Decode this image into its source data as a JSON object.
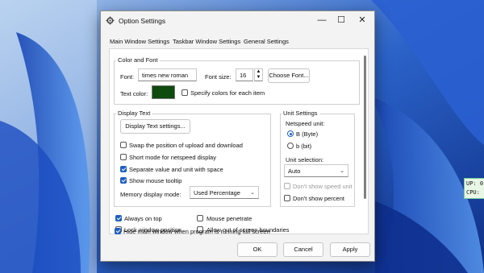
{
  "colors": {
    "wallpaper": "#1f53b8",
    "accent": "#1f5fbf",
    "text_color_swatch": "#0f4a0f"
  },
  "window": {
    "title": "Option Settings",
    "app_icon": "settings-app-icon",
    "minimize": "—",
    "maximize": "☐",
    "close": "✕"
  },
  "tabs": [
    "Main Window Settings",
    "Taskbar Window Settings",
    "General Settings"
  ],
  "color_font": {
    "group_label": "Color and Font",
    "font_label": "Font:",
    "font_value": "times new roman",
    "font_size_label": "Font size:",
    "font_size_value": "16",
    "choose_font_button": "Choose Font...",
    "text_color_label": "Text color:",
    "specify_colors_label": "Specify colors for each item"
  },
  "display_text": {
    "group_label": "Display Text",
    "settings_button": "Display Text settings...",
    "options": [
      {
        "label": "Swap the position of upload and download",
        "checked": false
      },
      {
        "label": "Short mode for netspeed display",
        "checked": false
      },
      {
        "label": "Separate value and unit with space",
        "checked": true
      },
      {
        "label": "Show mouse tooltip",
        "checked": true
      }
    ],
    "memory_mode_label": "Memory display mode:",
    "memory_mode_value": "Used Percentage"
  },
  "unit_settings": {
    "group_label": "Unit Settings",
    "netspeed_unit_label": "Netspeed unit:",
    "byte_label": "B (Byte)",
    "bit_label": "b (bit)",
    "unit_selection_label": "Unit selection:",
    "unit_selection_value": "Auto",
    "dont_show_speed_unit": "Don't show speed unit",
    "dont_show_percent": "Don't show percent"
  },
  "bottom_options": {
    "always_on_top": "Always on top",
    "mouse_penetrate": "Mouse penetrate",
    "lock_window_position": "Lock window position",
    "allow_out_of_screen": "Allow out of screen boundaries",
    "hide_main_window": "Hide main window when program is running full screen"
  },
  "footer": {
    "ok": "OK",
    "cancel": "Cancel",
    "apply": "Apply"
  },
  "overlay": {
    "up_label": "UP: 0.",
    "cpu_label": "CPU:"
  }
}
